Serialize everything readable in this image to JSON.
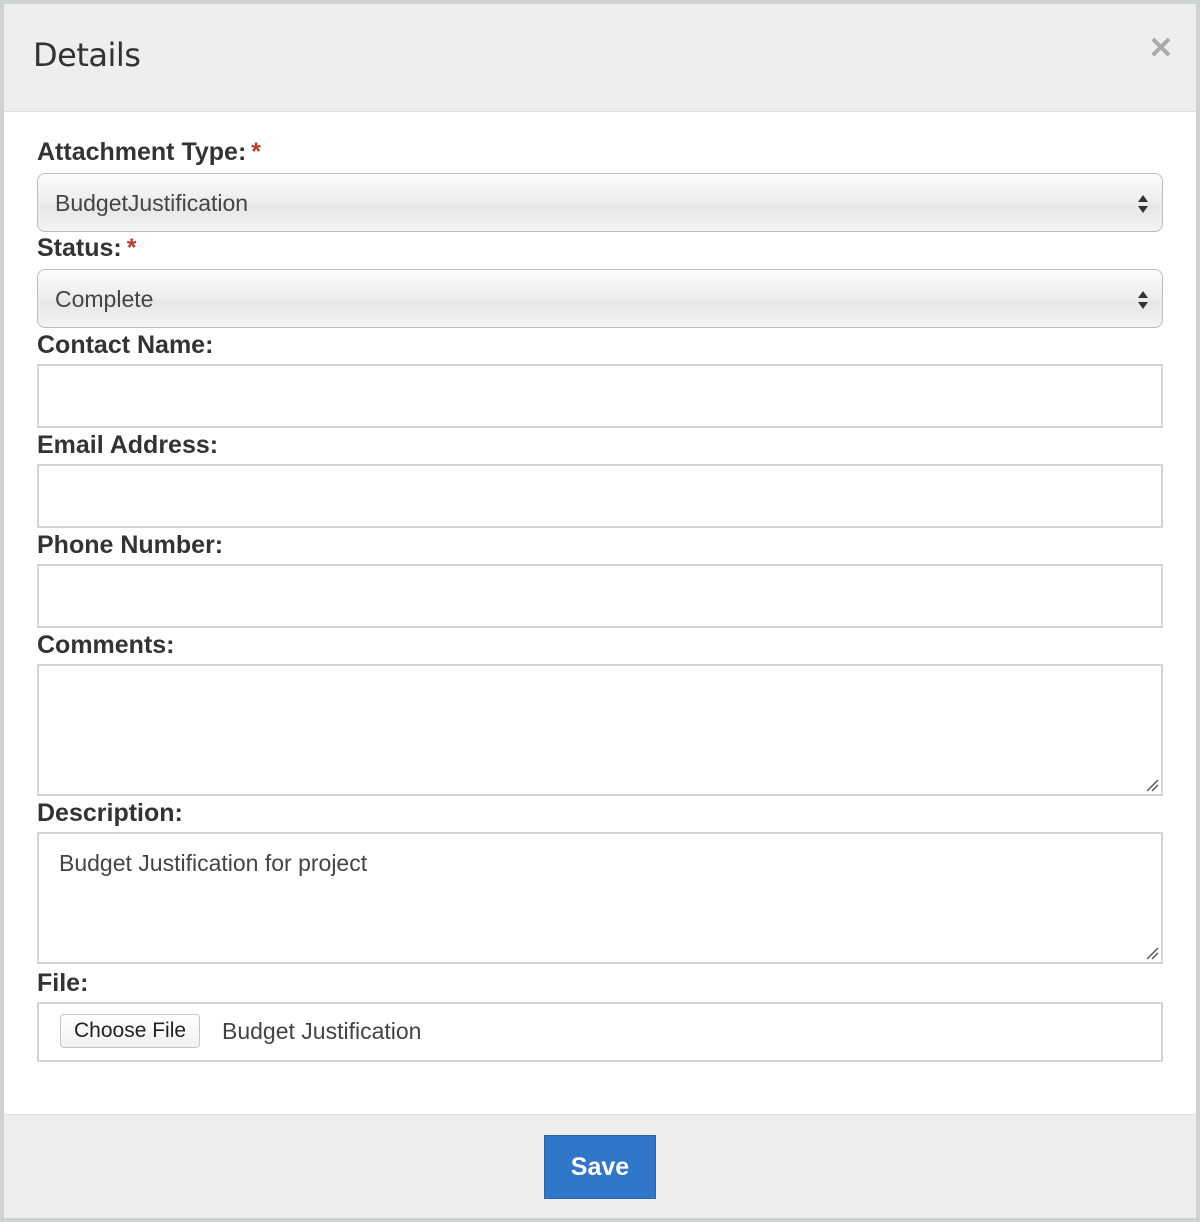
{
  "dialog": {
    "title": "Details",
    "close_icon": "close-icon"
  },
  "fields": {
    "attachment_type": {
      "label": "Attachment Type:",
      "required_mark": "*",
      "value": "BudgetJustification"
    },
    "status": {
      "label": "Status:",
      "required_mark": "*",
      "value": "Complete"
    },
    "contact_name": {
      "label": "Contact Name:",
      "value": ""
    },
    "email_address": {
      "label": "Email Address:",
      "value": ""
    },
    "phone_number": {
      "label": "Phone Number:",
      "value": ""
    },
    "comments": {
      "label": "Comments:",
      "value": ""
    },
    "description": {
      "label": "Description:",
      "value": "Budget Justification for project"
    },
    "file": {
      "label": "File:",
      "button_label": "Choose File",
      "file_name": "Budget Justification"
    }
  },
  "footer": {
    "save_label": "Save"
  },
  "colors": {
    "required": "#c0392b",
    "primary_button": "#3077c9",
    "header_bg": "#eeeeee"
  }
}
